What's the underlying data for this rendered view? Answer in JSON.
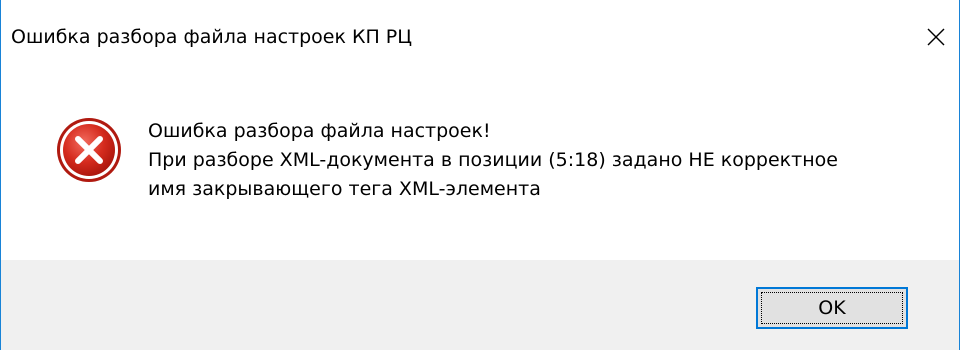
{
  "dialog": {
    "title": "Ошибка разбора файла настроек КП РЦ",
    "close_icon": "close-icon",
    "icon": "error-icon",
    "message": {
      "line1": "Ошибка разбора файла настроек!",
      "line2": "При разборе XML-документа в позиции (5:18) задано НЕ корректное",
      "line3": "имя закрывающего тега XML-элемента"
    },
    "ok_label": "OK",
    "colors": {
      "accent": "#0078d7",
      "window_border": "#1883d7",
      "footer_bg": "#f0f0f0",
      "error_red": "#d52b1e"
    }
  }
}
